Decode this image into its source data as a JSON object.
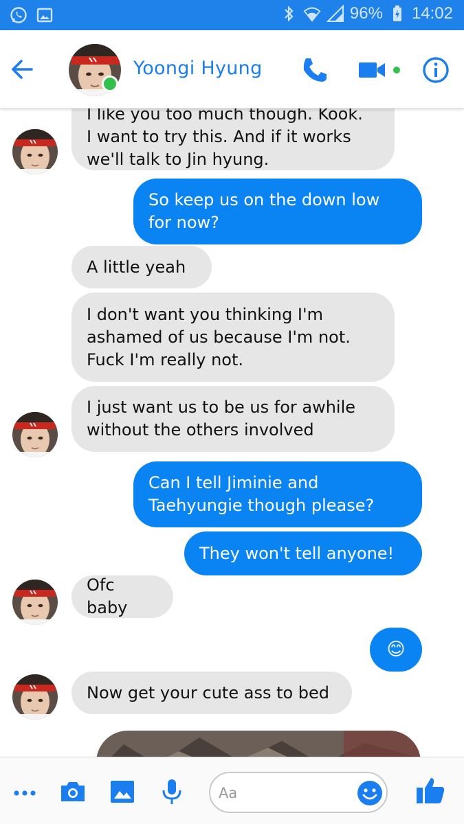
{
  "status_bar": {
    "battery": "96%",
    "time": "14:02"
  },
  "header": {
    "contact_name": "Yoongi Hyung"
  },
  "messages": [
    {
      "from": "them",
      "text": "I like you too much though. Kook.\nI want to try this. And if it works\nwe'll talk to Jin hyung."
    },
    {
      "from": "me",
      "text": "So keep us on the down low\nfor now?"
    },
    {
      "from": "them",
      "text": "A little yeah"
    },
    {
      "from": "them",
      "text": "I don't want you thinking I'm\nashamed of us because I'm not.\nFuck I'm really not."
    },
    {
      "from": "them",
      "text": "I just want us to be us for awhile\nwithout the others involved"
    },
    {
      "from": "me",
      "text": "Can I tell Jiminie and\nTaehyungie though please?"
    },
    {
      "from": "me",
      "text": "They won't tell anyone!"
    },
    {
      "from": "them",
      "text": "Ofc baby"
    },
    {
      "from": "me",
      "text": "😊"
    },
    {
      "from": "them",
      "text": "Now get your cute ass to bed"
    }
  ],
  "composer": {
    "placeholder": "Aa"
  },
  "colors": {
    "accent": "#0b84f3",
    "status_bar": "#1e82ea",
    "incoming_bubble": "#e6e6e6",
    "online": "#31c04b"
  },
  "icons": {
    "status_left": [
      "whatsapp-icon",
      "image-icon"
    ],
    "status_right": [
      "bluetooth-icon",
      "wifi-icon",
      "signal-icon",
      "battery-icon"
    ],
    "header": [
      "back-arrow-icon",
      "phone-icon",
      "video-camera-icon",
      "info-icon"
    ],
    "composer": [
      "more-icon",
      "camera-icon",
      "gallery-icon",
      "microphone-icon",
      "emoji-icon",
      "thumbs-up-icon"
    ]
  }
}
